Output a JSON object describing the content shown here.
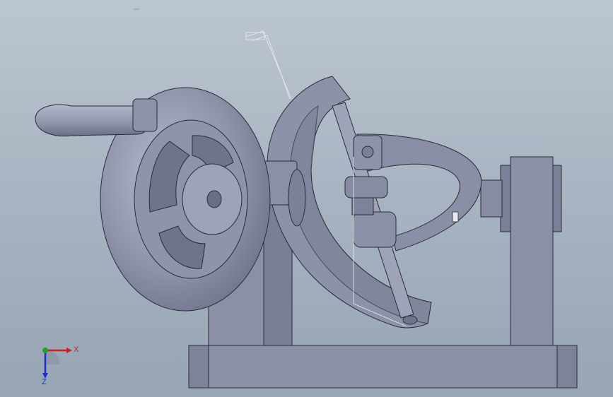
{
  "viewport": {
    "background_top": "#bcc6d1",
    "background_bottom": "#97a5b4",
    "part_color": "#8e93a9",
    "part_shadow": "#6f748b",
    "part_highlight": "#b4b8cb",
    "edge_color": "#2a2c38"
  },
  "triad": {
    "x_label": "X",
    "z_label": "Z",
    "x_color": "#cc1f1f",
    "y_color": "#1fa51f",
    "z_color": "#1f2fcc"
  }
}
